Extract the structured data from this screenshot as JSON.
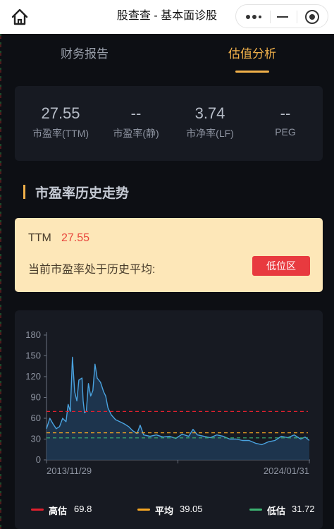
{
  "title_bar": {
    "title": "股查查 - 基本面诊股",
    "icons": [
      "home-icon",
      "more-icon",
      "minimize-icon",
      "close-target-icon"
    ]
  },
  "tabs": [
    {
      "label": "财务报告",
      "active": false
    },
    {
      "label": "估值分析",
      "active": true
    }
  ],
  "metrics": [
    {
      "value": "27.55",
      "label": "市盈率(TTM)"
    },
    {
      "value": "--",
      "label": "市盈率(静)"
    },
    {
      "value": "3.74",
      "label": "市净率(LF)"
    },
    {
      "value": "--",
      "label": "PEG"
    }
  ],
  "section": {
    "title": "市盈率历史走势"
  },
  "status": {
    "ttm_label": "TTM",
    "ttm_value": "27.55",
    "text": "当前市盈率处于历史平均:",
    "zone": "低位区"
  },
  "colors": {
    "accent": "#f0b04a",
    "high": "#e0202e",
    "avg": "#f5a623",
    "low": "#3cb371",
    "line": "#4aa3e0",
    "status_bg": "#fde7b8"
  },
  "legend": [
    {
      "name": "高估",
      "value": "69.8"
    },
    {
      "name": "平均",
      "value": "39.05"
    },
    {
      "name": "低估",
      "value": "31.72"
    }
  ],
  "chart_data": {
    "type": "area",
    "title": "",
    "xlabel": "",
    "ylabel": "",
    "ylim": [
      0,
      180
    ],
    "y_ticks": [
      "0",
      "30",
      "60",
      "90",
      "120",
      "150",
      "180"
    ],
    "x_tick_labels": [
      "2013/11/29",
      "2024/01/31"
    ],
    "x_range": [
      "2013/11/29",
      "2024/01/31"
    ],
    "grid": false,
    "legend_position": "bottom",
    "reference_lines": [
      {
        "name": "高估",
        "value": 69.8
      },
      {
        "name": "平均",
        "value": 39.05
      },
      {
        "name": "低估",
        "value": 31.72
      }
    ],
    "series": [
      {
        "name": "",
        "points": [
          [
            "2013-11-29",
            45
          ],
          [
            "2014-01-15",
            60
          ],
          [
            "2014-03-01",
            52
          ],
          [
            "2014-04-15",
            45
          ],
          [
            "2014-06-01",
            48
          ],
          [
            "2014-07-15",
            60
          ],
          [
            "2014-09-01",
            55
          ],
          [
            "2014-10-01",
            80
          ],
          [
            "2014-11-01",
            70
          ],
          [
            "2014-12-01",
            148
          ],
          [
            "2015-01-01",
            98
          ],
          [
            "2015-02-01",
            85
          ],
          [
            "2015-03-01",
            115
          ],
          [
            "2015-04-15",
            118
          ],
          [
            "2015-05-01",
            85
          ],
          [
            "2015-05-20",
            68
          ],
          [
            "2015-06-15",
            70
          ],
          [
            "2015-07-15",
            110
          ],
          [
            "2015-08-15",
            92
          ],
          [
            "2015-09-15",
            100
          ],
          [
            "2015-10-15",
            138
          ],
          [
            "2015-11-15",
            118
          ],
          [
            "2016-01-01",
            112
          ],
          [
            "2016-02-15",
            98
          ],
          [
            "2016-03-15",
            92
          ],
          [
            "2016-04-15",
            75
          ],
          [
            "2016-06-01",
            65
          ],
          [
            "2016-08-01",
            58
          ],
          [
            "2016-10-01",
            55
          ],
          [
            "2016-12-01",
            52
          ],
          [
            "2017-02-01",
            48
          ],
          [
            "2017-04-01",
            42
          ],
          [
            "2017-06-01",
            38
          ],
          [
            "2017-07-15",
            50
          ],
          [
            "2017-09-01",
            36
          ],
          [
            "2017-12-01",
            34
          ],
          [
            "2018-03-01",
            36
          ],
          [
            "2018-06-01",
            33
          ],
          [
            "2018-09-01",
            34
          ],
          [
            "2018-12-01",
            31
          ],
          [
            "2019-03-01",
            37
          ],
          [
            "2019-06-01",
            34
          ],
          [
            "2019-08-01",
            44
          ],
          [
            "2019-10-01",
            36
          ],
          [
            "2020-01-01",
            34
          ],
          [
            "2020-04-01",
            32
          ],
          [
            "2020-07-01",
            36
          ],
          [
            "2020-10-01",
            34
          ],
          [
            "2021-01-01",
            30
          ],
          [
            "2021-04-01",
            30
          ],
          [
            "2021-07-01",
            28
          ],
          [
            "2021-10-01",
            28
          ],
          [
            "2022-01-01",
            24
          ],
          [
            "2022-04-01",
            22
          ],
          [
            "2022-07-01",
            26
          ],
          [
            "2022-10-01",
            28
          ],
          [
            "2023-01-01",
            34
          ],
          [
            "2023-04-01",
            32
          ],
          [
            "2023-07-01",
            36
          ],
          [
            "2023-10-01",
            30
          ],
          [
            "2023-12-01",
            33
          ],
          [
            "2024-01-31",
            28
          ]
        ]
      }
    ]
  }
}
